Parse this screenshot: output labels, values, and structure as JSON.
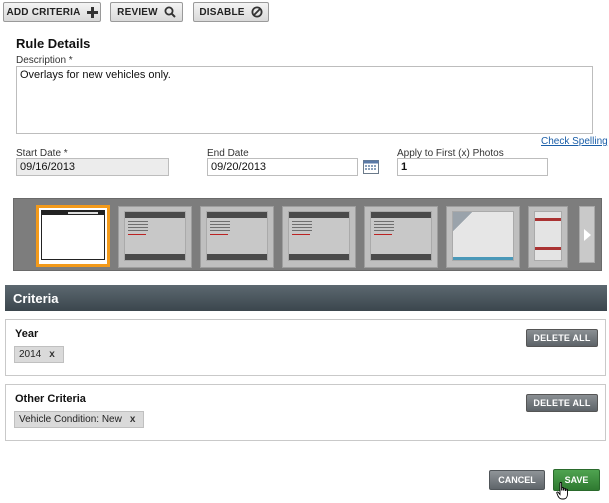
{
  "toolbar": {
    "add_criteria": "ADD CRITERIA",
    "review": "REVIEW",
    "disable": "DISABLE"
  },
  "rule_details": {
    "title": "Rule Details",
    "description_label": "Description *",
    "description_value": "Overlays for new vehicles only.",
    "check_spelling": "Check Spelling",
    "start_date_label": "Start Date *",
    "start_date_value": "09/16/2013",
    "end_date_label": "End Date",
    "end_date_value": "09/20/2013",
    "apply_label": "Apply to First (x) Photos",
    "apply_value": "1"
  },
  "carousel": {
    "selected_index": 0,
    "thumbnail_count": 7
  },
  "criteria": {
    "header": "Criteria",
    "groups": [
      {
        "title": "Year",
        "chips": [
          "2014"
        ],
        "delete_label": "DELETE ALL"
      },
      {
        "title": "Other Criteria",
        "chips": [
          "Vehicle Condition: New"
        ],
        "delete_label": "DELETE ALL"
      }
    ]
  },
  "footer": {
    "cancel": "CANCEL",
    "save": "SAVE"
  },
  "colors": {
    "selected_border": "#f39a1a",
    "save_green": "#2f7a31",
    "header_dark": "#3b464d",
    "link_blue": "#1a5ea8"
  },
  "icons": [
    "plus-icon",
    "search-icon",
    "disable-icon",
    "calendar-icon",
    "chevron-right-icon",
    "remove-icon",
    "hand-cursor-icon"
  ]
}
